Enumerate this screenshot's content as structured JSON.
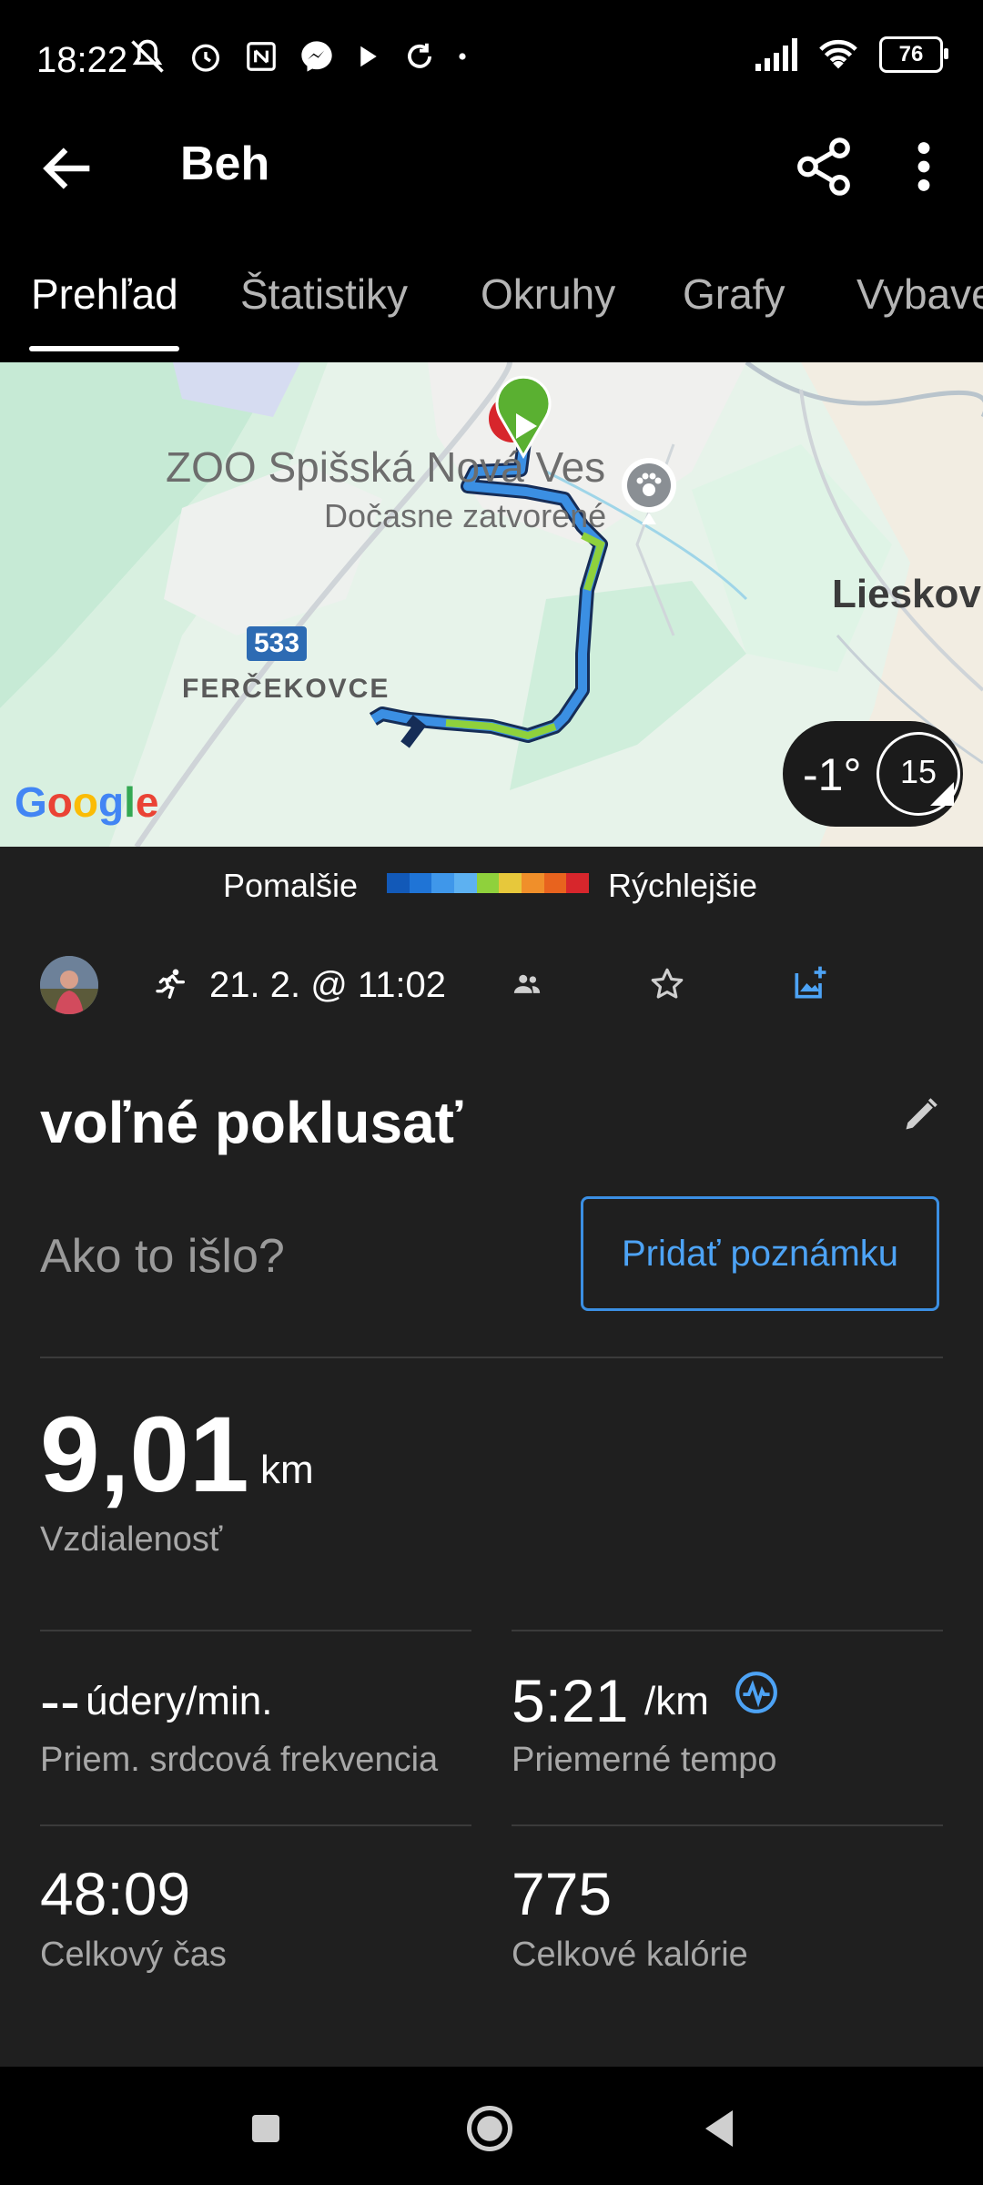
{
  "status_bar": {
    "time": "18:22",
    "battery": "76"
  },
  "header": {
    "title": "Beh"
  },
  "tabs": [
    {
      "label": "Prehľad"
    },
    {
      "label": "Štatistiky"
    },
    {
      "label": "Okruhy"
    },
    {
      "label": "Grafy"
    },
    {
      "label": "Vybave"
    }
  ],
  "map": {
    "place_name": "ZOO Spišská Nová Ves",
    "place_status": "Dočasne zatvorené",
    "town_right": "Lieskov",
    "village": "FERČEKOVCE",
    "road_number": "533",
    "provider": "Google"
  },
  "weather": {
    "temp": "-1°",
    "wind": "15"
  },
  "pace_legend": {
    "slower": "Pomalšie",
    "faster": "Rýchlejšie",
    "colors": [
      "#1259b8",
      "#1f74d6",
      "#3f97ea",
      "#5db1f1",
      "#8fd13c",
      "#e7c83b",
      "#f08f2a",
      "#e8631e",
      "#d7262c"
    ]
  },
  "activity": {
    "datetime": "21. 2. @ 11:02",
    "title": "voľné poklusať",
    "feel_prompt": "Ako to išlo?",
    "note_button": "Pridať poznámku"
  },
  "stats": {
    "distance": {
      "value": "9,01",
      "unit": "km",
      "label": "Vzdialenosť"
    },
    "heart_rate": {
      "value": "--",
      "unit": "údery/min.",
      "label": "Priem. srdcová frekvencia"
    },
    "pace": {
      "value": "5:21",
      "unit": "/km",
      "label": "Priemerné tempo"
    },
    "time": {
      "value": "48:09",
      "label": "Celkový čas"
    },
    "calories": {
      "value": "775",
      "label": "Celkové kalórie"
    }
  }
}
